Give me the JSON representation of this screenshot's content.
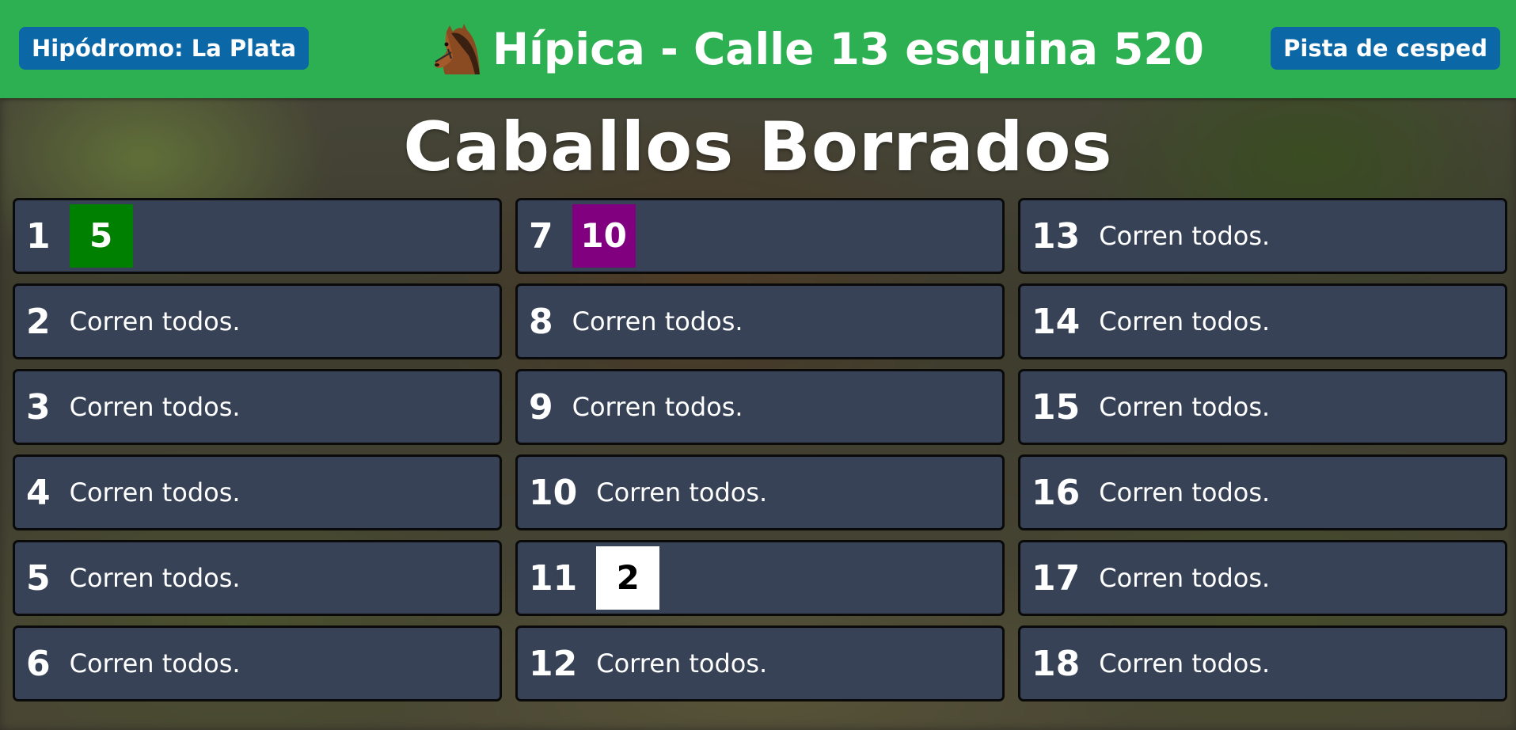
{
  "header": {
    "left_pill": "Hipódromo: La Plata",
    "title": "Hípica - Calle 13 esquina 520",
    "right_pill": "Pista de cesped",
    "icon": "horse-head-icon",
    "color": "#2db052",
    "pill_color": "#0b67a6"
  },
  "page_title": "Caballos Borrados",
  "races": [
    {
      "number": "1",
      "text": "",
      "scratched": [
        {
          "value": "5",
          "bg": "#008000",
          "fg": "#ffffff"
        }
      ]
    },
    {
      "number": "2",
      "text": "Corren todos.",
      "scratched": []
    },
    {
      "number": "3",
      "text": "Corren todos.",
      "scratched": []
    },
    {
      "number": "4",
      "text": "Corren todos.",
      "scratched": []
    },
    {
      "number": "5",
      "text": "Corren todos.",
      "scratched": []
    },
    {
      "number": "6",
      "text": "Corren todos.",
      "scratched": []
    },
    {
      "number": "7",
      "text": "",
      "scratched": [
        {
          "value": "10",
          "bg": "#800080",
          "fg": "#ffffff"
        }
      ]
    },
    {
      "number": "8",
      "text": "Corren todos.",
      "scratched": []
    },
    {
      "number": "9",
      "text": "Corren todos.",
      "scratched": []
    },
    {
      "number": "10",
      "text": "Corren todos.",
      "scratched": []
    },
    {
      "number": "11",
      "text": "",
      "scratched": [
        {
          "value": "2",
          "bg": "#ffffff",
          "fg": "#000000"
        }
      ]
    },
    {
      "number": "12",
      "text": "Corren todos.",
      "scratched": []
    },
    {
      "number": "13",
      "text": "Corren todos.",
      "scratched": []
    },
    {
      "number": "14",
      "text": "Corren todos.",
      "scratched": []
    },
    {
      "number": "15",
      "text": "Corren todos.",
      "scratched": []
    },
    {
      "number": "16",
      "text": "Corren todos.",
      "scratched": []
    },
    {
      "number": "17",
      "text": "Corren todos.",
      "scratched": []
    },
    {
      "number": "18",
      "text": "Corren todos.",
      "scratched": []
    }
  ]
}
